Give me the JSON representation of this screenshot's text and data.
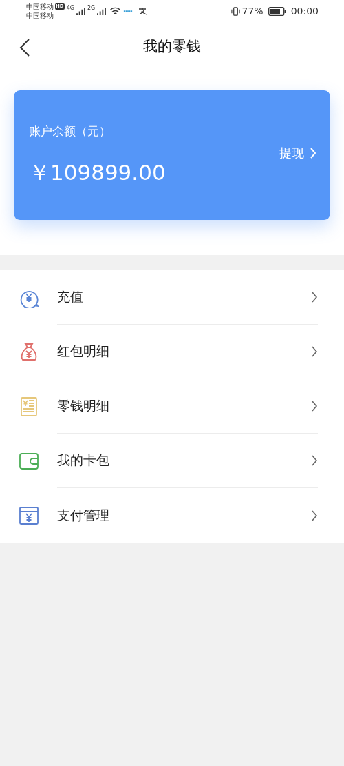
{
  "status_bar": {
    "carrier_1": "中国移动",
    "carrier_badge": "HD",
    "carrier_2": "中国移动",
    "signal_1_label": "4G",
    "signal_2_label": "2G",
    "battery_percent": "77%",
    "time": "00:00"
  },
  "nav": {
    "title": "我的零钱"
  },
  "balance_card": {
    "label": "账户余额（元）",
    "amount": "￥109899.00",
    "action": "提现"
  },
  "menu": [
    {
      "kind": "recharge",
      "label": "充值",
      "color": "#5b86d6"
    },
    {
      "kind": "red-packet",
      "label": "红包明细",
      "color": "#e0706c"
    },
    {
      "kind": "ledger",
      "label": "零钱明细",
      "color": "#e6c77a"
    },
    {
      "kind": "wallet",
      "label": "我的卡包",
      "color": "#4cae56"
    },
    {
      "kind": "payment",
      "label": "支付管理",
      "color": "#5a7fd0"
    }
  ]
}
